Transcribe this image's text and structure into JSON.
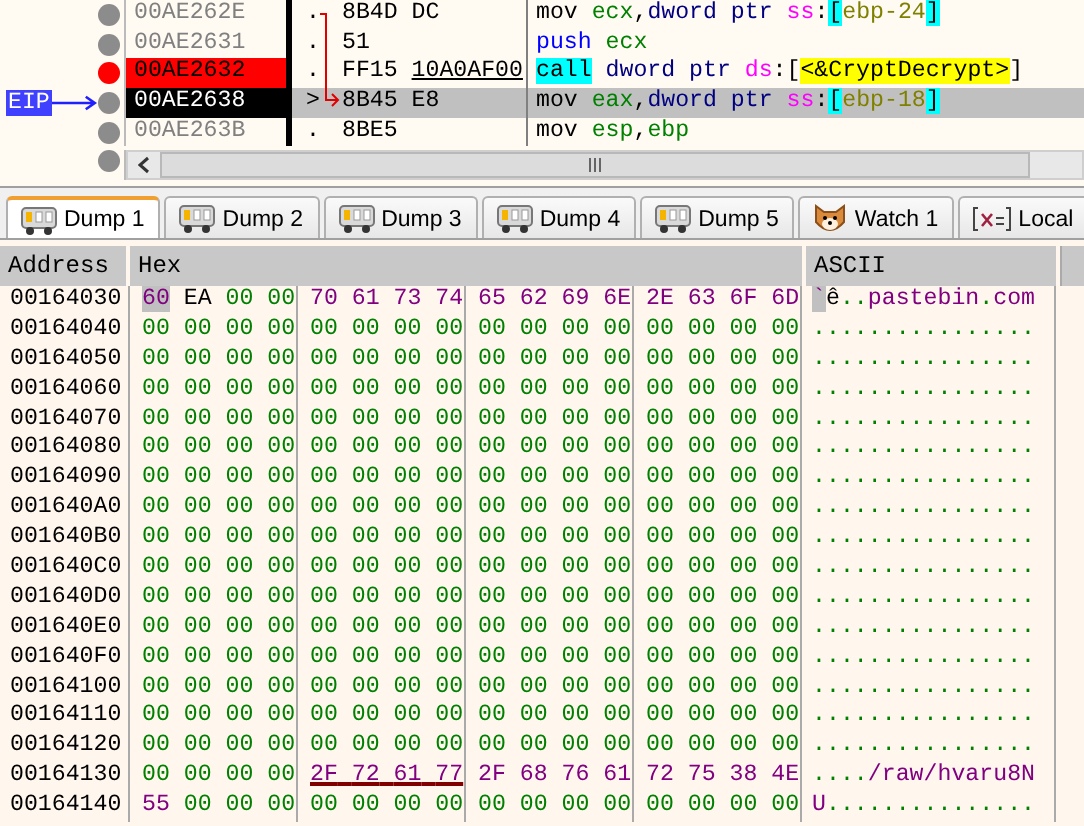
{
  "disassembly": {
    "rows": [
      {
        "address": "00AE262E",
        "breakpoint": false,
        "current": false,
        "marker": ".",
        "bytes": [
          {
            "text": "8B4D DC",
            "underlined": false
          }
        ],
        "instruction": [
          {
            "text": "mov ",
            "kind": "mnemonic"
          },
          {
            "text": "ecx",
            "kind": "register"
          },
          {
            "text": ",",
            "kind": "plain"
          },
          {
            "text": "dword ptr ",
            "kind": "size"
          },
          {
            "text": "ss",
            "kind": "segment"
          },
          {
            "text": ":",
            "kind": "plain"
          },
          {
            "text": "[",
            "kind": "bracket"
          },
          {
            "text": "ebp-24",
            "kind": "expr"
          },
          {
            "text": "]",
            "kind": "bracket"
          }
        ]
      },
      {
        "address": "00AE2631",
        "breakpoint": false,
        "current": false,
        "marker": ".",
        "bytes": [
          {
            "text": "51",
            "underlined": false
          }
        ],
        "instruction": [
          {
            "text": "push ",
            "kind": "stack"
          },
          {
            "text": "ecx",
            "kind": "register"
          }
        ]
      },
      {
        "address": "00AE2632",
        "breakpoint": true,
        "current": false,
        "marker": ".",
        "bytes": [
          {
            "text": "FF15 ",
            "underlined": false
          },
          {
            "text": "10A0AF00",
            "underlined": true
          }
        ],
        "instruction": [
          {
            "text": "call",
            "kind": "call"
          },
          {
            "text": " dword ptr ",
            "kind": "size"
          },
          {
            "text": "ds",
            "kind": "segment"
          },
          {
            "text": ":[",
            "kind": "plain"
          },
          {
            "text": "<&CryptDecrypt>",
            "kind": "symbol"
          },
          {
            "text": "]",
            "kind": "plain"
          }
        ]
      },
      {
        "address": "00AE2638",
        "breakpoint": false,
        "current": true,
        "marker": ">",
        "bytes": [
          {
            "text": "8B45 E8",
            "underlined": false
          }
        ],
        "instruction": [
          {
            "text": "mov ",
            "kind": "mnemonic"
          },
          {
            "text": "eax",
            "kind": "register"
          },
          {
            "text": ",",
            "kind": "plain"
          },
          {
            "text": "dword ptr ",
            "kind": "size"
          },
          {
            "text": "ss",
            "kind": "segment"
          },
          {
            "text": ":",
            "kind": "plain"
          },
          {
            "text": "[",
            "kind": "bracket"
          },
          {
            "text": "ebp-18",
            "kind": "expr"
          },
          {
            "text": "]",
            "kind": "bracket"
          }
        ]
      },
      {
        "address": "00AE263B",
        "breakpoint": false,
        "current": false,
        "marker": ".",
        "bytes": [
          {
            "text": "8BE5",
            "underlined": false
          }
        ],
        "instruction": [
          {
            "text": "mov ",
            "kind": "mnemonic"
          },
          {
            "text": "esp",
            "kind": "register"
          },
          {
            "text": ",",
            "kind": "plain"
          },
          {
            "text": "ebp",
            "kind": "register"
          }
        ]
      }
    ],
    "eip_label": "EIP"
  },
  "tabs": [
    {
      "label": "Dump 1",
      "kind": "dump",
      "selected": true
    },
    {
      "label": "Dump 2",
      "kind": "dump",
      "selected": false
    },
    {
      "label": "Dump 3",
      "kind": "dump",
      "selected": false
    },
    {
      "label": "Dump 4",
      "kind": "dump",
      "selected": false
    },
    {
      "label": "Dump 5",
      "kind": "dump",
      "selected": false
    },
    {
      "label": "Watch 1",
      "kind": "watch",
      "selected": false
    },
    {
      "label": "Local",
      "kind": "locals",
      "selected": false
    }
  ],
  "dump": {
    "columns": [
      "Address",
      "Hex",
      "ASCII"
    ],
    "rows": [
      {
        "address": "00164030",
        "cursor": true,
        "groups": [
          {
            "bytes": [
              "60",
              "EA",
              "00",
              "00"
            ],
            "underlined": false
          },
          {
            "bytes": [
              "70",
              "61",
              "73",
              "74"
            ],
            "underlined": false
          },
          {
            "bytes": [
              "65",
              "62",
              "69",
              "6E"
            ],
            "underlined": false
          },
          {
            "bytes": [
              "2E",
              "63",
              "6F",
              "6D"
            ],
            "underlined": false
          }
        ],
        "ascii": "`ê..pastebin.com"
      },
      {
        "address": "00164040",
        "cursor": false,
        "groups": [
          {
            "bytes": [
              "00",
              "00",
              "00",
              "00"
            ],
            "underlined": false
          },
          {
            "bytes": [
              "00",
              "00",
              "00",
              "00"
            ],
            "underlined": false
          },
          {
            "bytes": [
              "00",
              "00",
              "00",
              "00"
            ],
            "underlined": false
          },
          {
            "bytes": [
              "00",
              "00",
              "00",
              "00"
            ],
            "underlined": false
          }
        ],
        "ascii": "................"
      },
      {
        "address": "00164050",
        "cursor": false,
        "groups": [
          {
            "bytes": [
              "00",
              "00",
              "00",
              "00"
            ],
            "underlined": false
          },
          {
            "bytes": [
              "00",
              "00",
              "00",
              "00"
            ],
            "underlined": false
          },
          {
            "bytes": [
              "00",
              "00",
              "00",
              "00"
            ],
            "underlined": false
          },
          {
            "bytes": [
              "00",
              "00",
              "00",
              "00"
            ],
            "underlined": false
          }
        ],
        "ascii": "................"
      },
      {
        "address": "00164060",
        "cursor": false,
        "groups": [
          {
            "bytes": [
              "00",
              "00",
              "00",
              "00"
            ],
            "underlined": false
          },
          {
            "bytes": [
              "00",
              "00",
              "00",
              "00"
            ],
            "underlined": false
          },
          {
            "bytes": [
              "00",
              "00",
              "00",
              "00"
            ],
            "underlined": false
          },
          {
            "bytes": [
              "00",
              "00",
              "00",
              "00"
            ],
            "underlined": false
          }
        ],
        "ascii": "................"
      },
      {
        "address": "00164070",
        "cursor": false,
        "groups": [
          {
            "bytes": [
              "00",
              "00",
              "00",
              "00"
            ],
            "underlined": false
          },
          {
            "bytes": [
              "00",
              "00",
              "00",
              "00"
            ],
            "underlined": false
          },
          {
            "bytes": [
              "00",
              "00",
              "00",
              "00"
            ],
            "underlined": false
          },
          {
            "bytes": [
              "00",
              "00",
              "00",
              "00"
            ],
            "underlined": false
          }
        ],
        "ascii": "................"
      },
      {
        "address": "00164080",
        "cursor": false,
        "groups": [
          {
            "bytes": [
              "00",
              "00",
              "00",
              "00"
            ],
            "underlined": false
          },
          {
            "bytes": [
              "00",
              "00",
              "00",
              "00"
            ],
            "underlined": false
          },
          {
            "bytes": [
              "00",
              "00",
              "00",
              "00"
            ],
            "underlined": false
          },
          {
            "bytes": [
              "00",
              "00",
              "00",
              "00"
            ],
            "underlined": false
          }
        ],
        "ascii": "................"
      },
      {
        "address": "00164090",
        "cursor": false,
        "groups": [
          {
            "bytes": [
              "00",
              "00",
              "00",
              "00"
            ],
            "underlined": false
          },
          {
            "bytes": [
              "00",
              "00",
              "00",
              "00"
            ],
            "underlined": false
          },
          {
            "bytes": [
              "00",
              "00",
              "00",
              "00"
            ],
            "underlined": false
          },
          {
            "bytes": [
              "00",
              "00",
              "00",
              "00"
            ],
            "underlined": false
          }
        ],
        "ascii": "................"
      },
      {
        "address": "001640A0",
        "cursor": false,
        "groups": [
          {
            "bytes": [
              "00",
              "00",
              "00",
              "00"
            ],
            "underlined": false
          },
          {
            "bytes": [
              "00",
              "00",
              "00",
              "00"
            ],
            "underlined": false
          },
          {
            "bytes": [
              "00",
              "00",
              "00",
              "00"
            ],
            "underlined": false
          },
          {
            "bytes": [
              "00",
              "00",
              "00",
              "00"
            ],
            "underlined": false
          }
        ],
        "ascii": "................"
      },
      {
        "address": "001640B0",
        "cursor": false,
        "groups": [
          {
            "bytes": [
              "00",
              "00",
              "00",
              "00"
            ],
            "underlined": false
          },
          {
            "bytes": [
              "00",
              "00",
              "00",
              "00"
            ],
            "underlined": false
          },
          {
            "bytes": [
              "00",
              "00",
              "00",
              "00"
            ],
            "underlined": false
          },
          {
            "bytes": [
              "00",
              "00",
              "00",
              "00"
            ],
            "underlined": false
          }
        ],
        "ascii": "................"
      },
      {
        "address": "001640C0",
        "cursor": false,
        "groups": [
          {
            "bytes": [
              "00",
              "00",
              "00",
              "00"
            ],
            "underlined": false
          },
          {
            "bytes": [
              "00",
              "00",
              "00",
              "00"
            ],
            "underlined": false
          },
          {
            "bytes": [
              "00",
              "00",
              "00",
              "00"
            ],
            "underlined": false
          },
          {
            "bytes": [
              "00",
              "00",
              "00",
              "00"
            ],
            "underlined": false
          }
        ],
        "ascii": "................"
      },
      {
        "address": "001640D0",
        "cursor": false,
        "groups": [
          {
            "bytes": [
              "00",
              "00",
              "00",
              "00"
            ],
            "underlined": false
          },
          {
            "bytes": [
              "00",
              "00",
              "00",
              "00"
            ],
            "underlined": false
          },
          {
            "bytes": [
              "00",
              "00",
              "00",
              "00"
            ],
            "underlined": false
          },
          {
            "bytes": [
              "00",
              "00",
              "00",
              "00"
            ],
            "underlined": false
          }
        ],
        "ascii": "................"
      },
      {
        "address": "001640E0",
        "cursor": false,
        "groups": [
          {
            "bytes": [
              "00",
              "00",
              "00",
              "00"
            ],
            "underlined": false
          },
          {
            "bytes": [
              "00",
              "00",
              "00",
              "00"
            ],
            "underlined": false
          },
          {
            "bytes": [
              "00",
              "00",
              "00",
              "00"
            ],
            "underlined": false
          },
          {
            "bytes": [
              "00",
              "00",
              "00",
              "00"
            ],
            "underlined": false
          }
        ],
        "ascii": "................"
      },
      {
        "address": "001640F0",
        "cursor": false,
        "groups": [
          {
            "bytes": [
              "00",
              "00",
              "00",
              "00"
            ],
            "underlined": false
          },
          {
            "bytes": [
              "00",
              "00",
              "00",
              "00"
            ],
            "underlined": false
          },
          {
            "bytes": [
              "00",
              "00",
              "00",
              "00"
            ],
            "underlined": false
          },
          {
            "bytes": [
              "00",
              "00",
              "00",
              "00"
            ],
            "underlined": false
          }
        ],
        "ascii": "................"
      },
      {
        "address": "00164100",
        "cursor": false,
        "groups": [
          {
            "bytes": [
              "00",
              "00",
              "00",
              "00"
            ],
            "underlined": false
          },
          {
            "bytes": [
              "00",
              "00",
              "00",
              "00"
            ],
            "underlined": false
          },
          {
            "bytes": [
              "00",
              "00",
              "00",
              "00"
            ],
            "underlined": false
          },
          {
            "bytes": [
              "00",
              "00",
              "00",
              "00"
            ],
            "underlined": false
          }
        ],
        "ascii": "................"
      },
      {
        "address": "00164110",
        "cursor": false,
        "groups": [
          {
            "bytes": [
              "00",
              "00",
              "00",
              "00"
            ],
            "underlined": false
          },
          {
            "bytes": [
              "00",
              "00",
              "00",
              "00"
            ],
            "underlined": false
          },
          {
            "bytes": [
              "00",
              "00",
              "00",
              "00"
            ],
            "underlined": false
          },
          {
            "bytes": [
              "00",
              "00",
              "00",
              "00"
            ],
            "underlined": false
          }
        ],
        "ascii": "................"
      },
      {
        "address": "00164120",
        "cursor": false,
        "groups": [
          {
            "bytes": [
              "00",
              "00",
              "00",
              "00"
            ],
            "underlined": false
          },
          {
            "bytes": [
              "00",
              "00",
              "00",
              "00"
            ],
            "underlined": false
          },
          {
            "bytes": [
              "00",
              "00",
              "00",
              "00"
            ],
            "underlined": false
          },
          {
            "bytes": [
              "00",
              "00",
              "00",
              "00"
            ],
            "underlined": false
          }
        ],
        "ascii": "................"
      },
      {
        "address": "00164130",
        "cursor": false,
        "groups": [
          {
            "bytes": [
              "00",
              "00",
              "00",
              "00"
            ],
            "underlined": false
          },
          {
            "bytes": [
              "2F",
              "72",
              "61",
              "77"
            ],
            "underlined": true
          },
          {
            "bytes": [
              "2F",
              "68",
              "76",
              "61"
            ],
            "underlined": false
          },
          {
            "bytes": [
              "72",
              "75",
              "38",
              "4E"
            ],
            "underlined": false
          }
        ],
        "ascii": "..../raw/hvaru8N"
      },
      {
        "address": "00164140",
        "cursor": false,
        "groups": [
          {
            "bytes": [
              "55",
              "00",
              "00",
              "00"
            ],
            "underlined": false
          },
          {
            "bytes": [
              "00",
              "00",
              "00",
              "00"
            ],
            "underlined": false
          },
          {
            "bytes": [
              "00",
              "00",
              "00",
              "00"
            ],
            "underlined": false
          },
          {
            "bytes": [
              "00",
              "00",
              "00",
              "00"
            ],
            "underlined": false
          }
        ],
        "ascii": "U..............."
      }
    ]
  }
}
